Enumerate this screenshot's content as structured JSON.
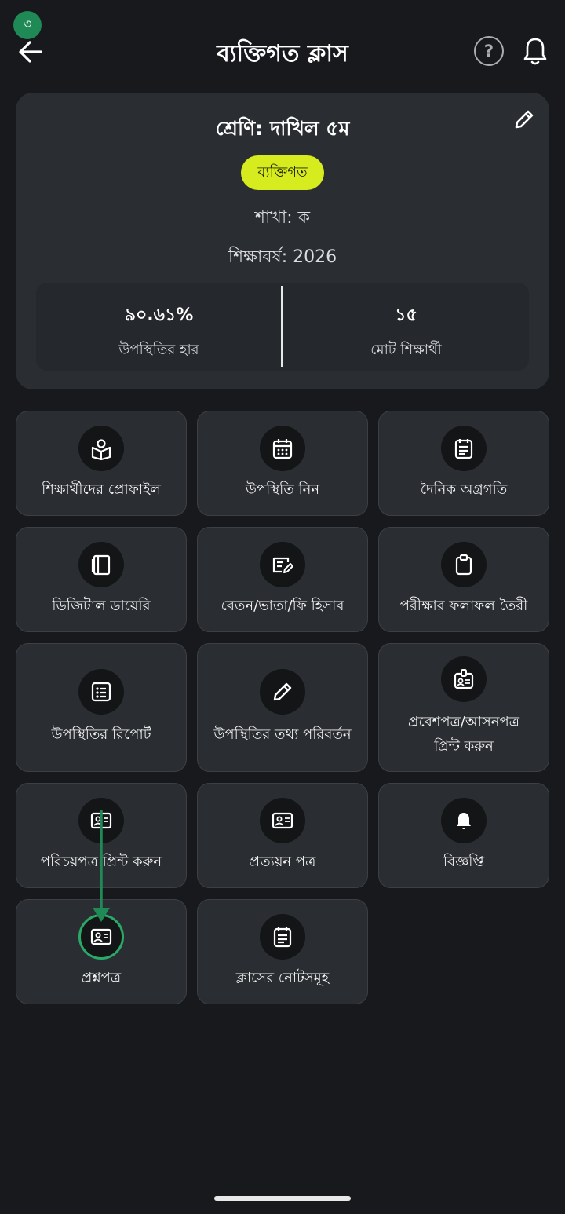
{
  "header": {
    "step_badge": "৩",
    "title": "ব্যক্তিগত ক্লাস",
    "help_glyph": "?"
  },
  "info_card": {
    "class_title": "শ্রেণি: দাখিল ৫ম",
    "type_badge": "ব্যক্তিগত",
    "section": "শাখা: ক",
    "session": "শিক্ষাবর্ষ: 2026",
    "stats": {
      "attendance_value": "৯০.৬১%",
      "attendance_label": "উপস্থিতির হার",
      "students_value": "১৫",
      "students_label": "মোট শিক্ষার্থী"
    }
  },
  "menu": [
    {
      "label": "শিক্ষার্থীদের প্রোফাইল",
      "icon": "student-profile-icon"
    },
    {
      "label": "উপস্থিতি নিন",
      "icon": "calendar-icon"
    },
    {
      "label": "দৈনিক অগ্রগতি",
      "icon": "daily-progress-icon"
    },
    {
      "label": "ডিজিটাল ডায়েরি",
      "icon": "diary-icon"
    },
    {
      "label": "বেতন/ভাতা/ফি হিসাব",
      "icon": "fee-edit-icon"
    },
    {
      "label": "পরীক্ষার ফলাফল তৈরী",
      "icon": "clipboard-icon"
    },
    {
      "label": "উপস্থিতির রিপোর্ট",
      "icon": "report-list-icon"
    },
    {
      "label": "উপস্থিতির তথ্য পরিবর্তন",
      "icon": "pencil-icon"
    },
    {
      "label": "প্রবেশপত্র/আসনপত্র",
      "label2": "প্রিন্ট করুন",
      "icon": "badge-icon"
    },
    {
      "label": "পরিচয়পত্র প্রিন্ট করুন",
      "icon": "id-card-icon"
    },
    {
      "label": "প্রত্যয়ন পত্র",
      "icon": "id-card-icon"
    },
    {
      "label": "বিজ্ঞপ্তি",
      "icon": "notification-bell-icon"
    },
    {
      "label": "প্রশ্নপত্র",
      "icon": "id-card-icon"
    },
    {
      "label": "ক্লাসের নোটসমূহ",
      "icon": "notes-icon"
    }
  ],
  "colors": {
    "background": "#17191c",
    "card": "#2a2d32",
    "accent_badge": "#d7ec1e",
    "step_badge": "#1f8a55",
    "highlight": "#2aa968"
  }
}
